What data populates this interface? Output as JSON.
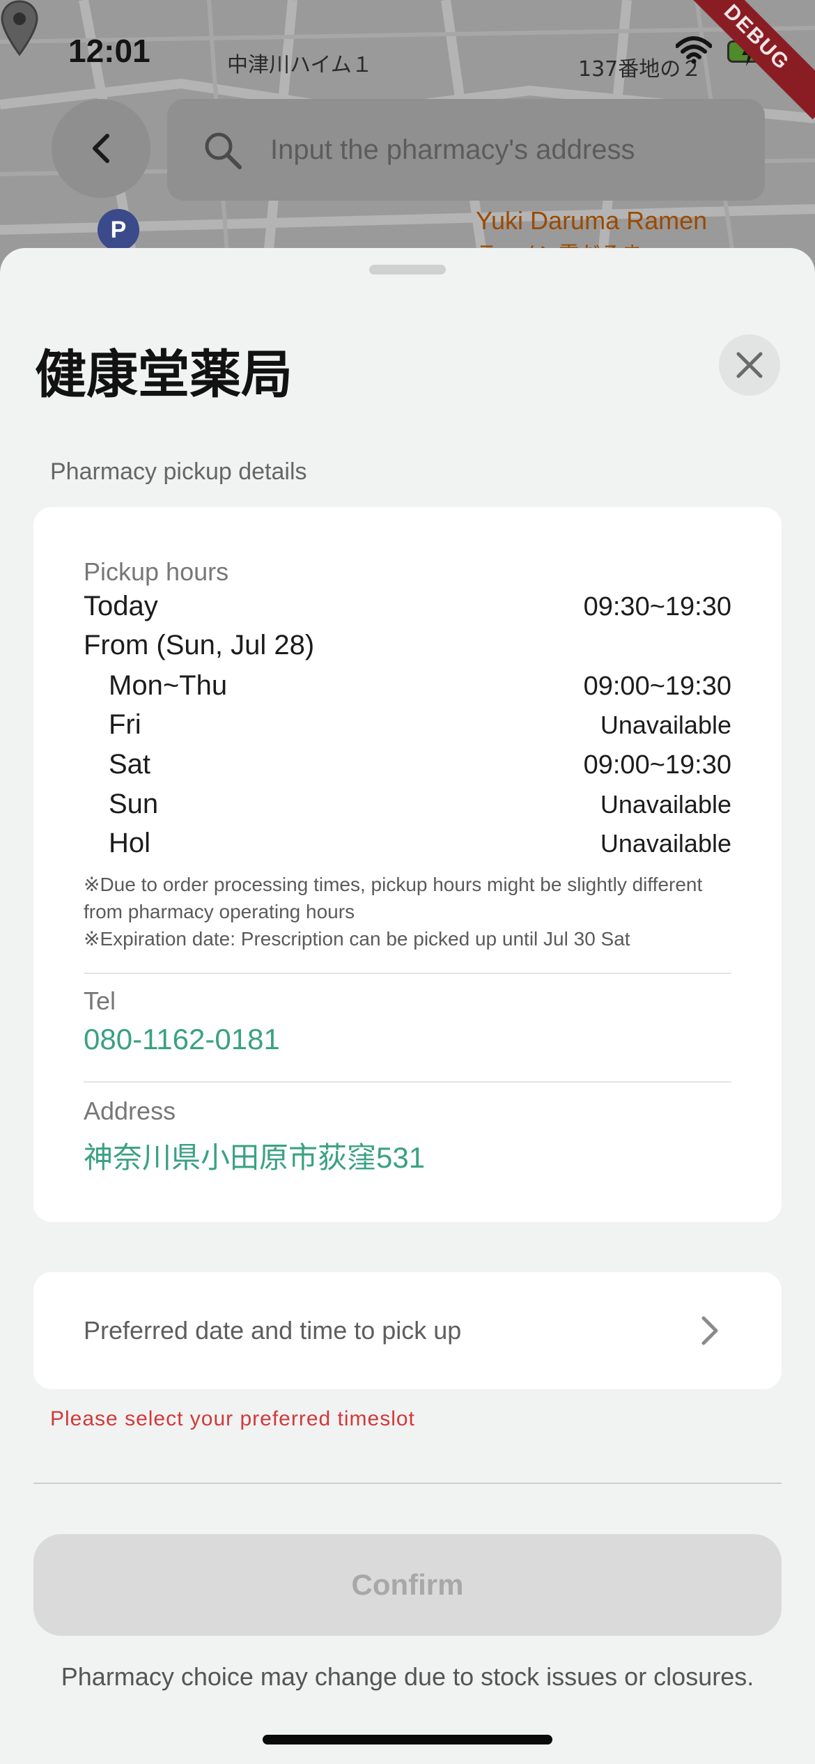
{
  "status_bar": {
    "time": "12:01"
  },
  "map": {
    "labels": [
      "中津川ハイム１",
      "137番地の２"
    ],
    "poi_name": "Yuki Daruma Ramen",
    "poi_subname": "ラーメン雪だるま",
    "parking_symbol": "P"
  },
  "debug_banner": "DEBUG",
  "search": {
    "placeholder": "Input the pharmacy's address"
  },
  "pharmacy": {
    "name": "健康堂薬局",
    "section_heading": "Pharmacy pickup details",
    "pickup_hours_label": "Pickup hours",
    "today_label": "Today",
    "today_hours": "09:30~19:30",
    "from_label": "From (Sun, Jul 28)",
    "schedule": [
      {
        "day": "Mon~Thu",
        "hours": "09:00~19:30"
      },
      {
        "day": "Fri",
        "hours": "Unavailable"
      },
      {
        "day": "Sat",
        "hours": "09:00~19:30"
      },
      {
        "day": "Sun",
        "hours": "Unavailable"
      },
      {
        "day": "Hol",
        "hours": "Unavailable"
      }
    ],
    "notes": [
      "※Due to order processing times, pickup hours might be slightly different from pharmacy operating hours",
      "※Expiration date: Prescription can be picked up until Jul 30 Sat"
    ],
    "tel_label": "Tel",
    "tel": "080-1162-0181",
    "address_label": "Address",
    "address": "神奈川県小田原市荻窪531"
  },
  "pickup_time": {
    "label": "Preferred date and time to pick up",
    "error": "Please select your preferred timeslot"
  },
  "confirm_label": "Confirm",
  "footnote": "Pharmacy choice may change due to stock issues or closures.",
  "colors": {
    "accent": "#3aa181",
    "error": "#cf3a3a",
    "sheet_bg": "#f1f2f2"
  }
}
